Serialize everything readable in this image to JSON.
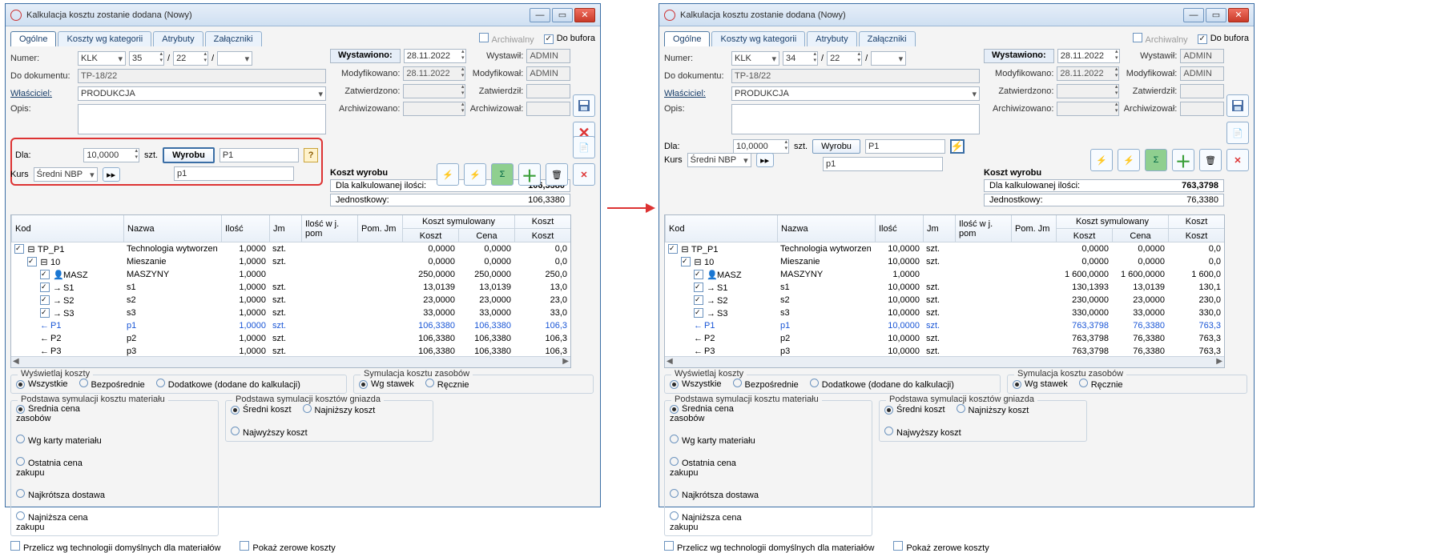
{
  "window_title": "Kalkulacja kosztu zostanie dodana  (Nowy)",
  "tabs": [
    "Ogólne",
    "Koszty wg kategorii",
    "Atrybuty",
    "Załączniki"
  ],
  "active_tab": 0,
  "archival_label": "Archiwalny",
  "buffer_label": "Do bufora",
  "labels": {
    "numer": "Numer:",
    "do_dokumentu": "Do dokumentu:",
    "wlasciciel": "Właściciel:",
    "opis": "Opis:",
    "dla": "Dla:",
    "szt": "szt.",
    "wyrobu": "Wyrobu",
    "koszt_wyrobu": "Koszt wyrobu",
    "dla_kalk": "Dla kalkulowanej ilości:",
    "jednostkowy": "Jednostkowy:",
    "wystawiono": "Wystawiono:",
    "modyfikowano": "Modyfikowano:",
    "zatwierdzono": "Zatwierdzono:",
    "archiwizowano": "Archiwizowano:",
    "wystawil": "Wystawił:",
    "modyfikowal": "Modyfikował:",
    "zatwierdzil": "Zatwierdził:",
    "archiwizowal": "Archiwizował:",
    "kurs": "Kurs"
  },
  "header_common": {
    "klk": "KLK",
    "slash": "/",
    "do_dokumentu_val": "TP-18/22",
    "wlasciciel_val": "PRODUKCJA",
    "wystawiono_date": "28.11.2022",
    "modyfikowano_date": "28.11.2022",
    "admin": "ADMIN",
    "dla_val": "10,0000",
    "p1": "P1",
    "p1_lower": "p1",
    "num2": "22"
  },
  "left": {
    "num1": "35",
    "koszt_calc": "106,3380",
    "koszt_jedn": "106,3380"
  },
  "right": {
    "num1": "34",
    "koszt_calc": "763,3798",
    "koszt_jedn": "76,3380"
  },
  "grid": {
    "cols": [
      "Kod",
      "Nazwa",
      "Ilość",
      "Jm",
      "Ilość w j. pom",
      "Pom. Jm",
      "Koszt",
      "Cena",
      "Koszt"
    ],
    "group_sim": "Koszt symulowany",
    "group_cost": "Koszt"
  },
  "grid_left": [
    {
      "chk": true,
      "indent": 0,
      "ico": "⊟",
      "kod": "TP_P1",
      "nazwa": "Technologia wytworzen",
      "ilosc": "1,0000",
      "jm": "szt.",
      "k": "0,0000",
      "c": "0,0000",
      "k2": "0,0"
    },
    {
      "chk": true,
      "indent": 1,
      "ico": "⊟",
      "kod": "10",
      "nazwa": "Mieszanie",
      "ilosc": "1,0000",
      "jm": "szt.",
      "k": "0,0000",
      "c": "0,0000",
      "k2": "0,0"
    },
    {
      "chk": true,
      "indent": 2,
      "ico": "👤",
      "kod": "MASZ",
      "nazwa": "MASZYNY",
      "ilosc": "1,0000",
      "jm": "",
      "k": "250,0000",
      "c": "250,0000",
      "k2": "250,0"
    },
    {
      "chk": true,
      "indent": 2,
      "ico": "→",
      "kod": "S1",
      "nazwa": "s1",
      "ilosc": "1,0000",
      "jm": "szt.",
      "k": "13,0139",
      "c": "13,0139",
      "k2": "13,0"
    },
    {
      "chk": true,
      "indent": 2,
      "ico": "→",
      "kod": "S2",
      "nazwa": "s2",
      "ilosc": "1,0000",
      "jm": "szt.",
      "k": "23,0000",
      "c": "23,0000",
      "k2": "23,0"
    },
    {
      "chk": true,
      "indent": 2,
      "ico": "→",
      "kod": "S3",
      "nazwa": "s3",
      "ilosc": "1,0000",
      "jm": "szt.",
      "k": "33,0000",
      "c": "33,0000",
      "k2": "33,0"
    },
    {
      "chk": false,
      "indent": 2,
      "ico": "←",
      "kod": "P1",
      "nazwa": "p1",
      "ilosc": "1,0000",
      "jm": "szt.",
      "k": "106,3380",
      "c": "106,3380",
      "k2": "106,3",
      "cls": "p1"
    },
    {
      "chk": false,
      "indent": 2,
      "ico": "←",
      "kod": "P2",
      "nazwa": "p2",
      "ilosc": "1,0000",
      "jm": "szt.",
      "k": "106,3380",
      "c": "106,3380",
      "k2": "106,3"
    },
    {
      "chk": false,
      "indent": 2,
      "ico": "←",
      "kod": "P3",
      "nazwa": "p3",
      "ilosc": "1,0000",
      "jm": "szt.",
      "k": "106,3380",
      "c": "106,3380",
      "k2": "106,3"
    }
  ],
  "grid_right": [
    {
      "chk": true,
      "indent": 0,
      "ico": "⊟",
      "kod": "TP_P1",
      "nazwa": "Technologia wytworzen",
      "ilosc": "10,0000",
      "jm": "szt.",
      "k": "0,0000",
      "c": "0,0000",
      "k2": "0,0"
    },
    {
      "chk": true,
      "indent": 1,
      "ico": "⊟",
      "kod": "10",
      "nazwa": "Mieszanie",
      "ilosc": "10,0000",
      "jm": "szt.",
      "k": "0,0000",
      "c": "0,0000",
      "k2": "0,0"
    },
    {
      "chk": true,
      "indent": 2,
      "ico": "👤",
      "kod": "MASZ",
      "nazwa": "MASZYNY",
      "ilosc": "1,0000",
      "jm": "",
      "k": "1 600,0000",
      "c": "1 600,0000",
      "k2": "1 600,0"
    },
    {
      "chk": true,
      "indent": 2,
      "ico": "→",
      "kod": "S1",
      "nazwa": "s1",
      "ilosc": "10,0000",
      "jm": "szt.",
      "k": "130,1393",
      "c": "13,0139",
      "k2": "130,1"
    },
    {
      "chk": true,
      "indent": 2,
      "ico": "→",
      "kod": "S2",
      "nazwa": "s2",
      "ilosc": "10,0000",
      "jm": "szt.",
      "k": "230,0000",
      "c": "23,0000",
      "k2": "230,0"
    },
    {
      "chk": true,
      "indent": 2,
      "ico": "→",
      "kod": "S3",
      "nazwa": "s3",
      "ilosc": "10,0000",
      "jm": "szt.",
      "k": "330,0000",
      "c": "33,0000",
      "k2": "330,0"
    },
    {
      "chk": false,
      "indent": 2,
      "ico": "←",
      "kod": "P1",
      "nazwa": "p1",
      "ilosc": "10,0000",
      "jm": "szt.",
      "k": "763,3798",
      "c": "76,3380",
      "k2": "763,3",
      "cls": "p1"
    },
    {
      "chk": false,
      "indent": 2,
      "ico": "←",
      "kod": "P2",
      "nazwa": "p2",
      "ilosc": "10,0000",
      "jm": "szt.",
      "k": "763,3798",
      "c": "76,3380",
      "k2": "763,3"
    },
    {
      "chk": false,
      "indent": 2,
      "ico": "←",
      "kod": "P3",
      "nazwa": "p3",
      "ilosc": "10,0000",
      "jm": "szt.",
      "k": "763,3798",
      "c": "76,3380",
      "k2": "763,3"
    }
  ],
  "display_costs": {
    "legend": "Wyświetlaj koszty",
    "opts": [
      "Wszystkie",
      "Bezpośrednie",
      "Dodatkowe (dodane do kalkulacji)"
    ],
    "sel": 0
  },
  "sim_res": {
    "legend": "Symulacja kosztu zasobów",
    "opts": [
      "Wg stawek",
      "Ręcznie"
    ],
    "sel": 0
  },
  "sim_mat": {
    "legend": "Podstawa symulacji kosztu materiału",
    "opts": [
      "Średnia cena zasobów",
      "Wg karty materiału",
      "Ostatnia cena zakupu",
      "Najkrótsza dostawa",
      "Najniższa cena zakupu"
    ],
    "sel": 0
  },
  "sim_gniazdo": {
    "legend": "Podstawa symulacji kosztów gniazda",
    "opts": [
      "Średni koszt",
      "Najniższy koszt",
      "Najwyższy koszt"
    ],
    "sel": 0
  },
  "checkboxes": {
    "przelicz": "Przelicz wg technologii domyślnych dla materiałów",
    "pokaz_zero": "Pokaż zerowe koszty"
  },
  "kurs_combo": "Średni NBP",
  "toolbar_icons": [
    "bolt1",
    "bolt2",
    "sum",
    "plus",
    "trash",
    "close-red"
  ]
}
